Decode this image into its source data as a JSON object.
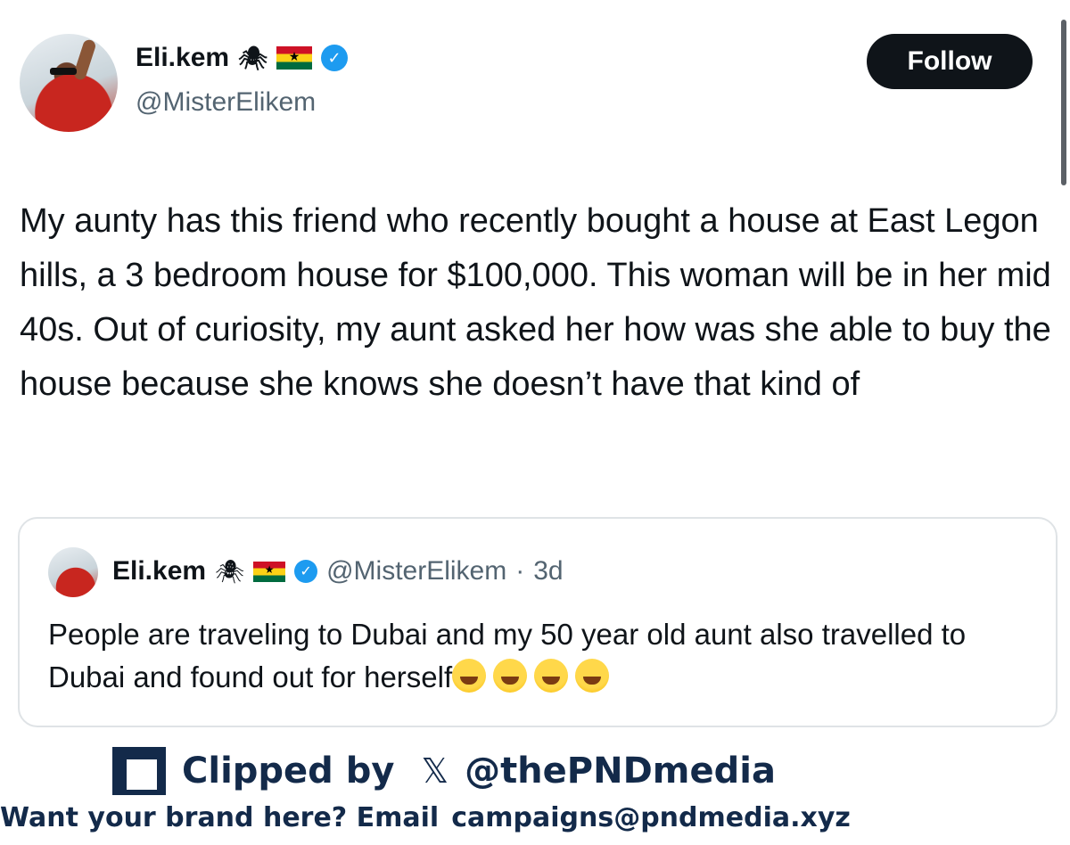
{
  "tweet": {
    "author_name": "Eli.kem",
    "spider_emoji": "🕷",
    "author_handle": "@MisterElikem",
    "follow_label": "Follow",
    "text": "My aunty has this friend who recently bought a house at East Legon hills, a 3 bedroom house for $100,000. This woman will be in her mid 40s. Out of curiosity, my aunt asked her how was she able to buy the house because she knows she doesn’t have that kind of"
  },
  "quote": {
    "author_name": "Eli.kem",
    "spider_emoji": "🕷",
    "author_handle": "@MisterElikem",
    "separator": "·",
    "time": "3d",
    "text": "People are traveling to Dubai and my 50 year old aunt also travelled to Dubai and found out for herself"
  },
  "branding": {
    "clipped_label": "Clipped by",
    "x_symbol": "𝕏",
    "clipped_handle": "@thePNDmedia",
    "cta_text": "Want your brand here? Email",
    "cta_email": "campaigns@pndmedia.xyz"
  }
}
